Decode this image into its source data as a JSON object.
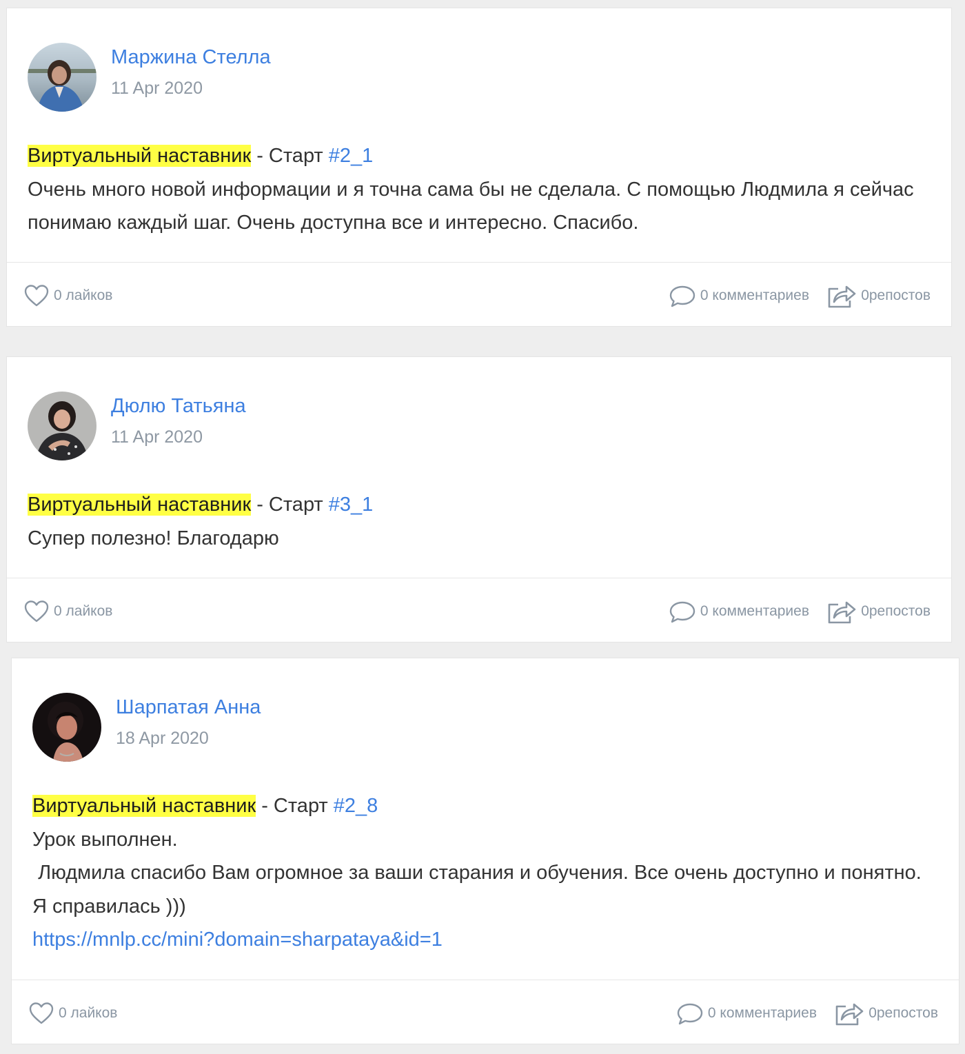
{
  "posts": [
    {
      "author": "Маржина Стелла",
      "date": "11 Apr 2020",
      "avatar": "avatar-photo-woman-outdoors",
      "highlight": "Виртуальный наставник",
      "sep": " - Старт ",
      "tag": "#2_1",
      "lines": [
        "Очень много новой информации и я точна сама бы не сделала. С помощью Людмила я сейчас понимаю каждый шаг. Очень доступна все и интересно. Спасибо."
      ],
      "link": "",
      "likes": "0 лайков",
      "comments": "0 комментариев",
      "reposts": "0репостов"
    },
    {
      "author": "Дюлю Татьяна",
      "date": "11 Apr 2020",
      "avatar": "avatar-photo-woman-portrait",
      "highlight": "Виртуальный наставник",
      "sep": " - Старт ",
      "tag": "#3_1",
      "lines": [
        "Супер полезно! Благодарю"
      ],
      "link": "",
      "likes": "0 лайков",
      "comments": "0 комментариев",
      "reposts": "0репостов"
    },
    {
      "author": "Шарпатая Анна",
      "date": "18 Apr 2020",
      "avatar": "avatar-photo-woman-dark",
      "highlight": "Виртуальный наставник",
      "sep": " - Старт ",
      "tag": "#2_8",
      "lines": [
        "Урок выполнен.",
        " Людмила спасибо Вам огромное за ваши старания и обучения. Все очень доступно и понятно. Я справилась )))"
      ],
      "link": "https://mnlp.cc/mini?domain=sharpataya&id=1",
      "likes": "0 лайков",
      "comments": "0 комментариев",
      "reposts": "0репостов"
    }
  ],
  "colors": {
    "accent": "#3d7fe0",
    "highlight": "#ffff44",
    "muted": "#8e98a3",
    "background": "#eeeeee"
  },
  "icons": [
    "heart-icon",
    "comment-icon",
    "repost-icon"
  ]
}
